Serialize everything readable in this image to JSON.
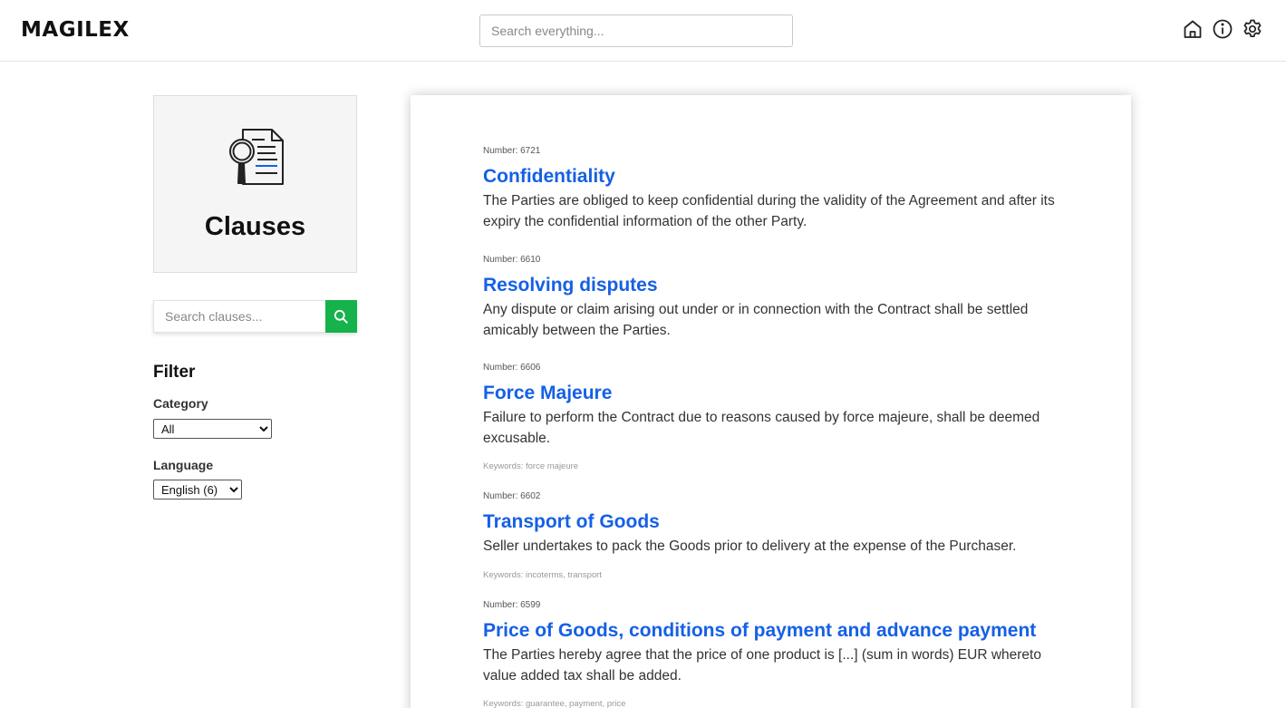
{
  "header": {
    "logo": "MAGILEX",
    "search_placeholder": "Search everything...",
    "icons": [
      "home-icon",
      "info-icon",
      "settings-icon"
    ]
  },
  "sidebar": {
    "card_title": "Clauses",
    "card_icon": "document-search-icon",
    "search_placeholder": "Search clauses...",
    "search_button_icon": "search-icon",
    "filter": {
      "title": "Filter",
      "category_label": "Category",
      "category_value": "All",
      "language_label": "Language",
      "language_value": "English (6)"
    }
  },
  "clauses": [
    {
      "number": "Number: 6721",
      "title": "Confidentiality",
      "text": "The Parties are obliged to keep confidential during the validity of the Agreement and after its expiry the confidential information of the other Party.",
      "keywords": ""
    },
    {
      "number": "Number: 6610",
      "title": "Resolving disputes",
      "text": "Any dispute or claim arising out under or in connection with the Contract shall be settled amicably between the Parties.",
      "keywords": ""
    },
    {
      "number": "Number: 6606",
      "title": "Force Majeure",
      "text": "Failure to perform the Contract due to reasons caused by force majeure, shall be deemed excusable.",
      "keywords": "Keywords: force majeure"
    },
    {
      "number": "Number: 6602",
      "title": "Transport of Goods",
      "text": "Seller undertakes to pack the Goods prior to delivery at the expense of the Purchaser.",
      "keywords": "Keywords: incoterms, transport"
    },
    {
      "number": "Number: 6599",
      "title": "Price of Goods, conditions of payment and advance payment",
      "text": "The Parties hereby agree that the price of one product is [...] (sum in words) EUR whereto value added tax shall be added.",
      "keywords": "Keywords: guarantee, payment, price"
    }
  ],
  "colors": {
    "accent_link": "#1560e6",
    "search_button": "#16b24b"
  }
}
